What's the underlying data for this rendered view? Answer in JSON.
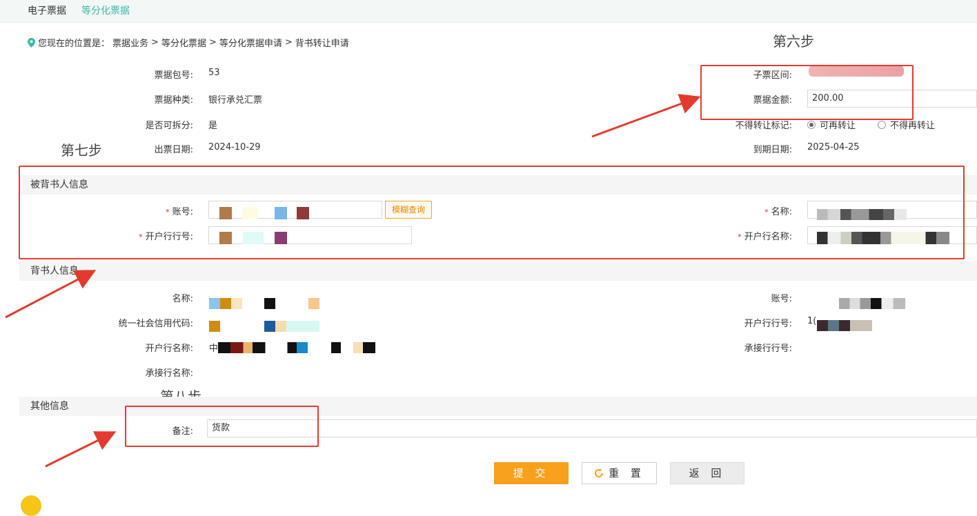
{
  "tabs": [
    {
      "label": "电子票据"
    },
    {
      "label": "等分化票据"
    }
  ],
  "breadcrumb": {
    "prefix": "您现在的位置是：",
    "items": [
      "票据业务",
      "等分化票据",
      "等分化票据申请",
      "背书转让申请"
    ],
    "separator": ">"
  },
  "annotations": {
    "step6": "第六步",
    "step7": "第七步",
    "step8": "第八步"
  },
  "bill": {
    "package_no_label": "票据包号:",
    "package_no": "53",
    "type_label": "票据种类:",
    "type": "银行承兑汇票",
    "splittable_label": "是否可拆分:",
    "splittable": "是",
    "issue_date_label": "出票日期:",
    "issue_date": "2024-10-29",
    "sub_range_label": "子票区间:",
    "amount_label": "票据金额:",
    "amount": "200.00",
    "transfer_mark_label": "不得转让标记:",
    "transfer_options": [
      "可再转让",
      "不得再转让"
    ],
    "transfer_selected": "可再转让",
    "due_date_label": "到期日期:",
    "due_date": "2025-04-25"
  },
  "endorsee": {
    "title": "被背书人信息",
    "account_label": "账号:",
    "fuzzy_button": "模糊查询",
    "name_label": "名称:",
    "bank_no_label": "开户行行号:",
    "bank_name_label": "开户行名称:"
  },
  "endorser": {
    "title": "背书人信息",
    "name_label": "名称:",
    "account_label": "账号:",
    "credit_code_label": "统一社会信用代码:",
    "bank_no_label": "开户行行号:",
    "bank_no_prefix": "1(",
    "bank_name_label": "开户行名称:",
    "bank_name_prefix": "中",
    "acceptor_no_label": "承接行行号:",
    "acceptor_name_label": "承接行名称:"
  },
  "other": {
    "title": "其他信息",
    "remark_label": "备注:",
    "remark": "货款"
  },
  "buttons": {
    "submit": "提 交",
    "reset": "重 置",
    "back": "返 回"
  },
  "colors": {
    "accent": "#3bb7a6",
    "submit": "#f9a01c",
    "annotation_red": "#e23b2e"
  }
}
